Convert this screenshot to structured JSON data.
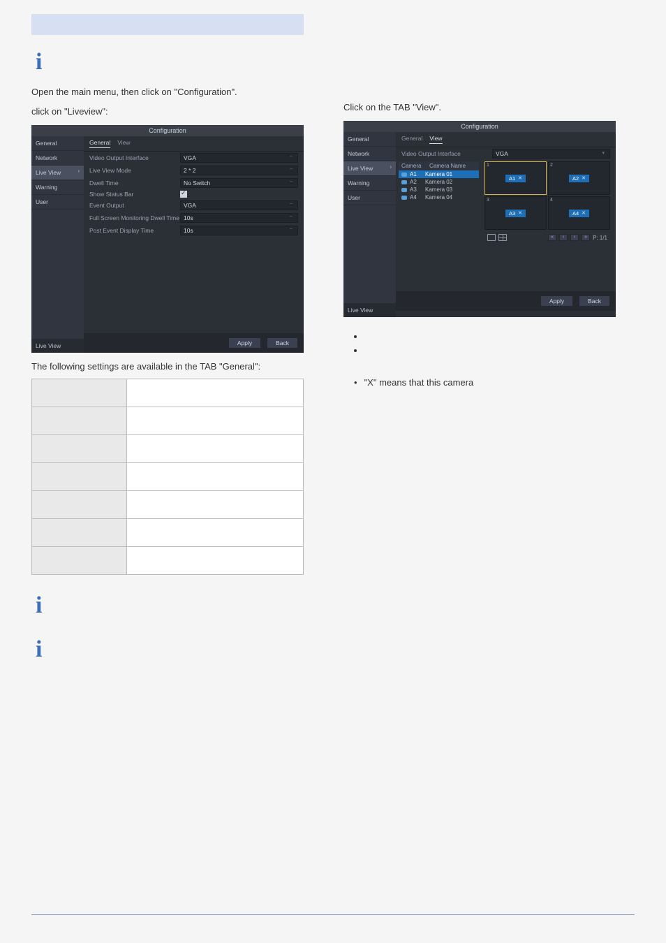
{
  "band": "",
  "info_glyph": "i",
  "left": {
    "intro_line1": "Open the main menu, then click on \"Configuration\".",
    "intro_line2": "click on \"Liveview\":",
    "cfg_title": "Configuration",
    "side": [
      "General",
      "Network",
      "Live View",
      "Warning",
      "User"
    ],
    "side_bottom": "Live View",
    "tabs": {
      "general": "General",
      "view": "View"
    },
    "rows": [
      {
        "label": "Video Output Interface",
        "value": "VGA"
      },
      {
        "label": "Live View Mode",
        "value": "2 * 2"
      },
      {
        "label": "Dwell Time",
        "value": "No Switch"
      },
      {
        "label": "Show Status Bar",
        "value": "__CHECK__"
      },
      {
        "label": "Event Output",
        "value": "VGA"
      },
      {
        "label": "Full Screen Monitoring Dwell Time",
        "value": "10s"
      },
      {
        "label": "Post Event Display Time",
        "value": "10s"
      }
    ],
    "apply": "Apply",
    "back": "Back",
    "following": "The following settings are available in the TAB \"General\":"
  },
  "right": {
    "click_tab": "Click on the TAB \"View\".",
    "cfg_title": "Configuration",
    "side": [
      "General",
      "Network",
      "Live View",
      "Warning",
      "User"
    ],
    "side_bottom": "Live View",
    "tabs": {
      "general": "General",
      "view": "View"
    },
    "voi_label": "Video Output Interface",
    "voi_value": "VGA",
    "cam_head": {
      "c1": "Camera",
      "c2": "Camera Name"
    },
    "cams": [
      {
        "id": "A1",
        "name": "Kamera 01",
        "sel": true
      },
      {
        "id": "A2",
        "name": "Kamera 02",
        "sel": false
      },
      {
        "id": "A3",
        "name": "Kamera 03",
        "sel": false
      },
      {
        "id": "A4",
        "name": "Kamera 04",
        "sel": false
      }
    ],
    "cells": [
      {
        "n": "1",
        "chip": "A1",
        "sel": true
      },
      {
        "n": "2",
        "chip": "A2",
        "sel": false
      },
      {
        "n": "3",
        "chip": "A3",
        "sel": false
      },
      {
        "n": "4",
        "chip": "A4",
        "sel": false
      }
    ],
    "page_label": "P: 1/1",
    "apply": "Apply",
    "back": "Back",
    "x_means": "\"X\" means that this camera"
  },
  "settings_rows": 7
}
